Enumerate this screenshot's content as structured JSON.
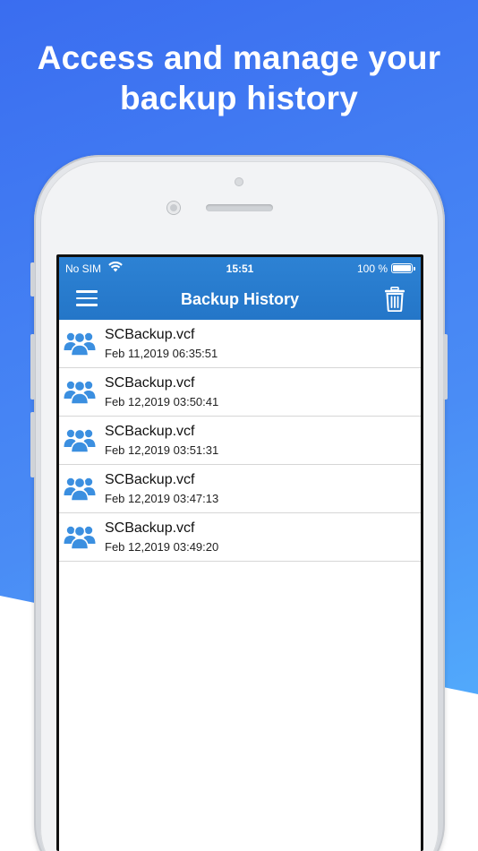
{
  "headline": {
    "line1": "Access and manage your",
    "line2": "backup history"
  },
  "status_bar": {
    "carrier": "No SIM",
    "time": "15:51",
    "battery": "100 %",
    "icons": [
      "wifi-icon",
      "battery-icon"
    ]
  },
  "app_bar": {
    "title": "Backup History",
    "left_icon": "hamburger-menu-icon",
    "right_icon": "trash-icon"
  },
  "colors": {
    "header_blue": "#2476c8",
    "promo_blue": "#3a6df0",
    "contact_icon_blue": "#3b8fe0"
  },
  "backups": [
    {
      "name": "SCBackup.vcf",
      "date": "Feb 11,2019 06:35:51",
      "icon": "contacts-group-icon"
    },
    {
      "name": "SCBackup.vcf",
      "date": "Feb 12,2019 03:50:41",
      "icon": "contacts-group-icon"
    },
    {
      "name": "SCBackup.vcf",
      "date": "Feb 12,2019 03:51:31",
      "icon": "contacts-group-icon"
    },
    {
      "name": "SCBackup.vcf",
      "date": "Feb 12,2019 03:47:13",
      "icon": "contacts-group-icon"
    },
    {
      "name": "SCBackup.vcf",
      "date": "Feb 12,2019 03:49:20",
      "icon": "contacts-group-icon"
    }
  ]
}
